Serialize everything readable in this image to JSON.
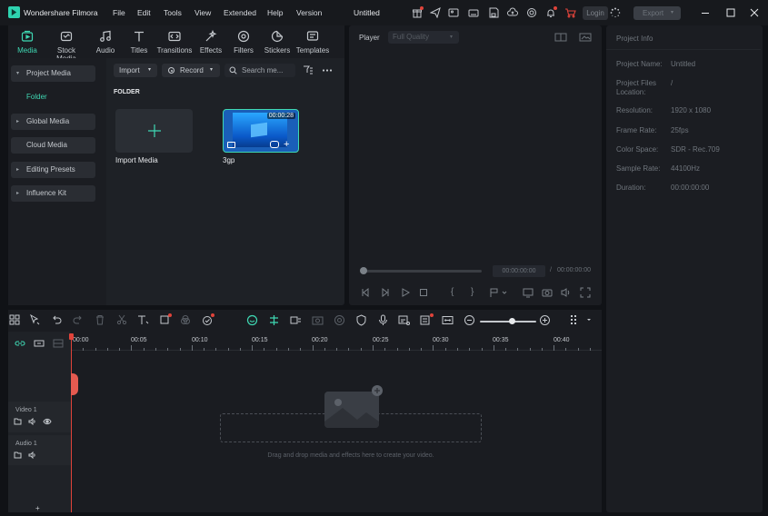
{
  "app": {
    "name": "Wondershare Filmora",
    "title": "Untitled"
  },
  "menu": [
    "File",
    "Edit",
    "Tools",
    "View",
    "Extended",
    "Help",
    "Version"
  ],
  "titlebar": {
    "login_label": "Login",
    "export_label": "Export"
  },
  "media_tabs": [
    {
      "label": "Media",
      "icon": "media-icon",
      "active": true
    },
    {
      "label": "Stock Media",
      "icon": "stock-media-icon"
    },
    {
      "label": "Audio",
      "icon": "audio-icon"
    },
    {
      "label": "Titles",
      "icon": "titles-icon"
    },
    {
      "label": "Transitions",
      "icon": "transitions-icon"
    },
    {
      "label": "Effects",
      "icon": "effects-icon"
    },
    {
      "label": "Filters",
      "icon": "filters-icon"
    },
    {
      "label": "Stickers",
      "icon": "stickers-icon"
    },
    {
      "label": "Templates",
      "icon": "templates-icon"
    }
  ],
  "sidebar": {
    "project_media": "Project Media",
    "folder": "Folder",
    "global_media": "Global Media",
    "cloud_media": "Cloud Media",
    "editing_presets": "Editing Presets",
    "influence_kit": "Influence Kit"
  },
  "media_toolbar": {
    "import_label": "Import",
    "record_label": "Record",
    "search_placeholder": "Search me..."
  },
  "media_area": {
    "folder_heading": "FOLDER",
    "import_label": "Import Media",
    "clip": {
      "name": "3gp",
      "duration": "00:00:28"
    }
  },
  "player": {
    "label": "Player",
    "quality": "Full Quality",
    "current_time": "00:00:00:00",
    "separator": "/",
    "total_time": "00:00:00:00"
  },
  "project_info": {
    "title": "Project Info",
    "rows": [
      {
        "label": "Project Name:",
        "value": "Untitled"
      },
      {
        "label": "Project Files Location:",
        "value": "/"
      },
      {
        "label": "Resolution:",
        "value": "1920 x 1080"
      },
      {
        "label": "Frame Rate:",
        "value": "25fps"
      },
      {
        "label": "Color Space:",
        "value": "SDR - Rec.709"
      },
      {
        "label": "Sample Rate:",
        "value": "44100Hz"
      },
      {
        "label": "Duration:",
        "value": "00:00:00:00"
      }
    ]
  },
  "timeline": {
    "ruler": [
      "00:00",
      "00:05",
      "00:10",
      "00:15",
      "00:20",
      "00:25",
      "00:30",
      "00:35",
      "00:40"
    ],
    "tracks": [
      {
        "name": "Video 1"
      },
      {
        "name": "Audio 1"
      }
    ],
    "drop_hint": "Drag and drop media and effects here to create your video.",
    "add_track_label": "+"
  },
  "colors": {
    "accent": "#3fd8b3",
    "playhead": "#e0433a",
    "bg": "#101216",
    "panel": "#1e2126"
  }
}
